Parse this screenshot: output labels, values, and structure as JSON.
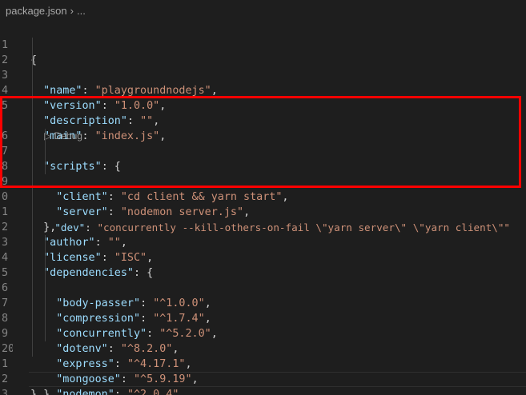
{
  "breadcrumb": {
    "file": "package.json",
    "chevron": "›",
    "ellipsis": "..."
  },
  "codelens": {
    "icon": "run-icon",
    "label": "Debug"
  },
  "line_numbers": [
    "1",
    "2",
    "3",
    "4",
    "5",
    "6",
    "7",
    "8",
    "9",
    "0",
    "1",
    "2",
    "3",
    "4",
    "5",
    "6",
    "7",
    "8",
    "9",
    "20",
    "1",
    "2",
    "3"
  ],
  "code": {
    "l1_open": "{",
    "name_key": "\"name\"",
    "name_val": "\"playgroundnodejs\"",
    "version_key": "\"version\"",
    "version_val": "\"1.0.0\"",
    "description_key": "\"description\"",
    "description_val": "\"\"",
    "main_key": "\"main\"",
    "main_val": "\"index.js\"",
    "scripts_key": "\"scripts\"",
    "client_key": "\"client\"",
    "client_val": "\"cd client && yarn start\"",
    "server_key": "\"server\"",
    "server_val": "\"nodemon server.js\"",
    "dev_key": "\"dev\"",
    "dev_val": "\"concurrently --kill-others-on-fail \\\"yarn server\\\" \\\"yarn client\\\"\"",
    "scripts_close": "},",
    "author_key": "\"author\"",
    "author_val": "\"\"",
    "license_key": "\"license\"",
    "license_val": "\"ISC\"",
    "deps_key": "\"dependencies\"",
    "bodyparser_key": "\"body-passer\"",
    "bodyparser_val": "\"^1.0.0\"",
    "compression_key": "\"compression\"",
    "compression_val": "\"^1.7.4\"",
    "concurrently_key": "\"concurrently\"",
    "concurrently_val": "\"^5.2.0\"",
    "dotenv_key": "\"dotenv\"",
    "dotenv_val": "\"^8.2.0\"",
    "express_key": "\"express\"",
    "express_val": "\"^4.17.1\"",
    "mongoose_key": "\"mongoose\"",
    "mongoose_val": "\"^5.9.19\"",
    "nodemon_key": "\"nodemon\"",
    "nodemon_val": "\"^2.0.4\"",
    "deps_close": "}",
    "l22_close": "}"
  },
  "colors": {
    "background": "#1e1e1e",
    "key": "#9cdcfe",
    "string": "#ce9178",
    "punctuation": "#d4d4d4",
    "line_number": "#858585",
    "highlight_box": "#ff0000"
  }
}
